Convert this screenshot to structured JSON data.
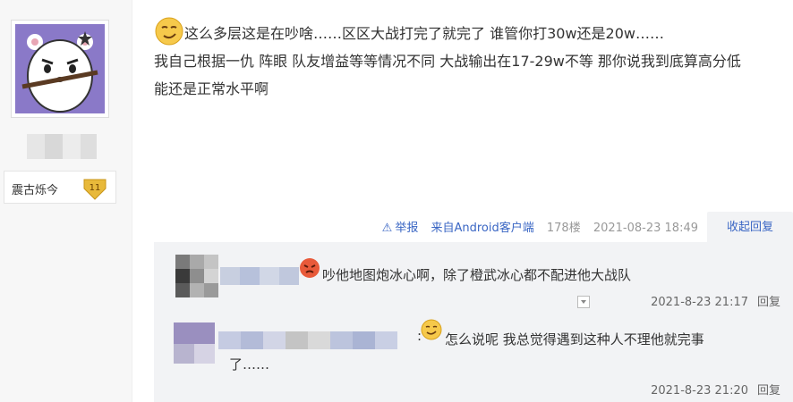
{
  "user": {
    "badge_name": "震古烁今",
    "level": "11"
  },
  "post": {
    "line1": "这么多层这是在吵啥……区区大战打完了就完了 谁管你打30w还是20w……",
    "line2": "我自己根据一仇 阵眼 队友增益等等情况不同 大战输出在17-29w不等 那你说我到底算高分低",
    "line3": "能还是正常水平啊",
    "emoji_icon": "smirk-face-icon"
  },
  "meta": {
    "report_label": "举报",
    "client": "来自Android客户端",
    "floor": "178楼",
    "time": "2021-08-23 18:49",
    "collapse_label": "收起回复"
  },
  "replies": [
    {
      "text": "吵他地图炮冰心啊，除了橙武冰心都不配进他大战队",
      "emoji_icon": "angry-face-icon",
      "time": "2021-8-23 21:17",
      "reply_label": "回复"
    },
    {
      "colon": ":",
      "text_line1": "怎么说呢 我总觉得遇到这种人不理他就完事",
      "text_line2": "了……",
      "emoji_icon": "smirk-face-icon",
      "time": "2021-8-23 21:20",
      "reply_label": "回复"
    }
  ],
  "colors": {
    "link": "#3a66c4",
    "reply_bg": "#f2f3f5",
    "badge_gold": "#e8b93a"
  }
}
